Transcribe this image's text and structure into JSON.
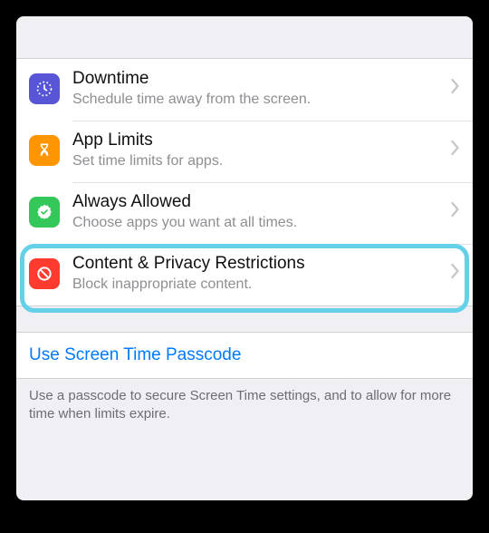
{
  "rows": [
    {
      "title": "Downtime",
      "subtitle": "Schedule time away from the screen."
    },
    {
      "title": "App Limits",
      "subtitle": "Set time limits for apps."
    },
    {
      "title": "Always Allowed",
      "subtitle": "Choose apps you want at all times."
    },
    {
      "title": "Content & Privacy Restrictions",
      "subtitle": "Block inappropriate content."
    }
  ],
  "passcode": {
    "link": "Use Screen Time Passcode",
    "footer": "Use a passcode to secure Screen Time settings, and to allow for more time when limits expire."
  }
}
